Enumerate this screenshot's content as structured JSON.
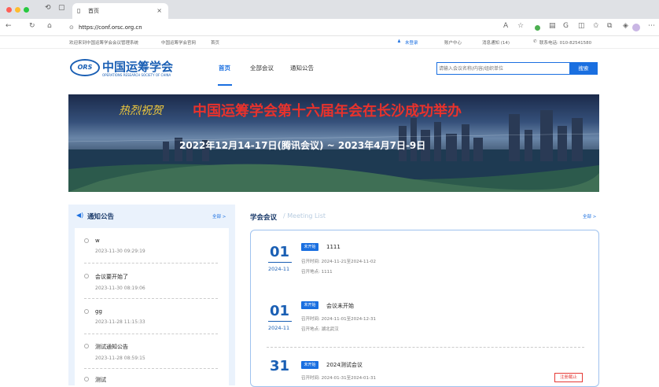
{
  "browser": {
    "tab_title": "首页",
    "url": "https://conf.orsc.org.cn"
  },
  "infobar": {
    "links": [
      "欢迎来到中国运筹学会会议管理系统",
      "中国运筹学会官网",
      "首页"
    ],
    "login": "未登录",
    "account": "账户中心",
    "messages": "消息通知 (14)",
    "phone": "联系电话: 010-82541580"
  },
  "header": {
    "logo_abbr": "ORS",
    "logo_text": "中国运筹学会",
    "logo_sub": "OPERATIONS RESEARCH SOCIETY OF CHINA",
    "nav": [
      "首页",
      "全部会议",
      "通知公告"
    ],
    "search_placeholder": "请输入会议名称/内容/组织单位",
    "search_button": "搜索"
  },
  "banner": {
    "headline_prefix": "热烈祝贺",
    "headline": "中国运筹学会第十六届年会在长沙成功举办",
    "dates": "2022年12月14-17日(腾讯会议) ~ 2023年4月7日-9日"
  },
  "notice": {
    "title": "通知公告",
    "more": "全部 >",
    "items": [
      {
        "title": "w",
        "time": "2023-11-30 09:29:19"
      },
      {
        "title": "会议要开始了",
        "time": "2023-11-30 08:19:06"
      },
      {
        "title": "gg",
        "time": "2023-11-28 11:15:33"
      },
      {
        "title": "测试通知公告",
        "time": "2023-11-28 08:59:15"
      },
      {
        "title": "测试",
        "time": ""
      }
    ]
  },
  "meetings": {
    "title": "学会会议",
    "subtitle": "/ Meeting List",
    "more": "全部 >",
    "items": [
      {
        "day": "01",
        "month": "2024-11",
        "status": "未开始",
        "name": "1111",
        "time": "召开时间: 2024-11-21至2024-11-02",
        "place": "召开地点: 1111"
      },
      {
        "day": "01",
        "month": "2024-11",
        "status": "未开始",
        "name": "会议未开始",
        "time": "召开时间: 2024-11-01至2024-12-31",
        "place": "召开地点: 湖北武汉"
      },
      {
        "day": "31",
        "month": "",
        "status": "未开始",
        "name": "2024测试会议",
        "time": "召开时间: 2024-01-31至2024-01-31",
        "place": "",
        "action": "注册截止"
      }
    ]
  }
}
